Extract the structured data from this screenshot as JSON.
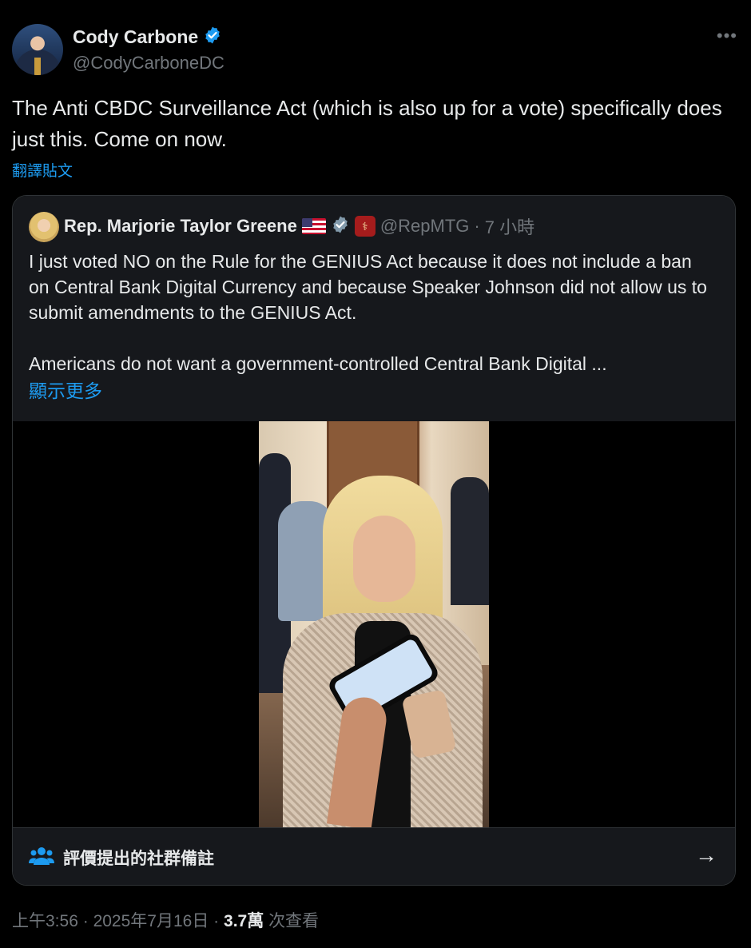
{
  "author": {
    "display_name": "Cody Carbone",
    "handle": "@CodyCarboneDC",
    "verified": true,
    "badge_color": "#1d9bf0"
  },
  "more_icon": "more-horizontal-icon",
  "tweet": {
    "text": "The Anti CBDC Surveillance Act (which is also up for a vote) specifically does just this. Come on now.",
    "translate_label": "翻譯貼文"
  },
  "quote": {
    "display_name": "Rep. Marjorie Taylor Greene",
    "flag": "🇺🇸",
    "verified": true,
    "handle": "@RepMTG",
    "separator": "·",
    "time": "7 小時",
    "text": "I just voted NO on the Rule for the GENIUS Act because it does not include a ban on Central Bank Digital Currency and because Speaker Johnson did not allow us to submit amendments to the GENIUS Act.\n\nAmericans do not want a government-controlled Central Bank Digital ...",
    "show_more": "顯示更多"
  },
  "community_notes": {
    "label": "評價提出的社群備註",
    "icon": "people-icon",
    "arrow_icon": "arrow-right-icon"
  },
  "meta": {
    "time": "上午3:56",
    "sep1": "·",
    "date": "2025年7月16日",
    "sep2": "·",
    "views_count": "3.7萬",
    "views_label": "次查看"
  },
  "colors": {
    "background": "#000000",
    "text": "#e7e9ea",
    "secondary": "#71767b",
    "link": "#1d9bf0",
    "border": "#2f3336",
    "panel": "#16181c"
  }
}
